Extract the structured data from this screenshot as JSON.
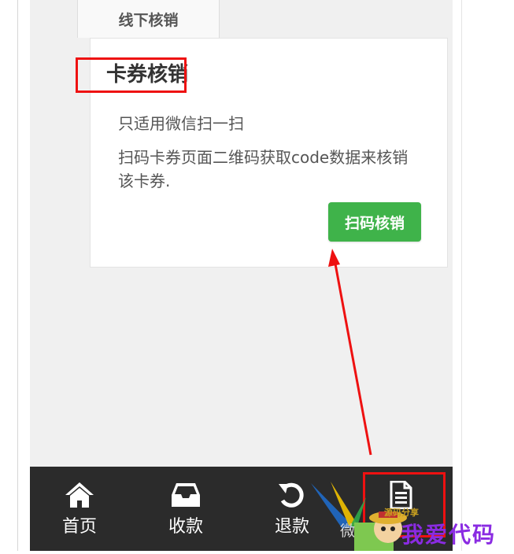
{
  "tabs": [
    {
      "label": "线下核销",
      "active": true
    }
  ],
  "card": {
    "title": "卡券核销",
    "subtitle": "只适用微信扫一扫",
    "description": "扫码卡券页面二维码获取code数据来核销该卡券.",
    "button_label": "扫码核销"
  },
  "bottom_nav": [
    {
      "label": "首页",
      "icon": "home-icon"
    },
    {
      "label": "收款",
      "icon": "inbox-icon"
    },
    {
      "label": "退款",
      "icon": "refresh-icon"
    },
    {
      "label": "",
      "icon": "document-icon"
    }
  ],
  "watermark": {
    "text": "我爱代码",
    "subtitle": "源码分享",
    "wechat_text": "微"
  },
  "colors": {
    "accent_button": "#3fb34a",
    "annotation": "#ee1111",
    "nav_background": "#2b2b2b"
  }
}
